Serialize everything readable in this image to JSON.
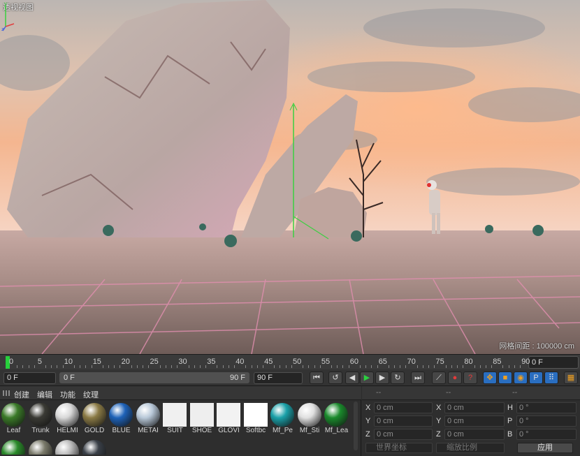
{
  "viewport": {
    "title": "透视视图",
    "grid_spacing": "网格间距 : 100000 cm"
  },
  "timeline": {
    "ticks": [
      "0",
      "5",
      "10",
      "15",
      "20",
      "25",
      "30",
      "35",
      "40",
      "45",
      "50",
      "55",
      "60",
      "65",
      "70",
      "75",
      "80",
      "85",
      "90"
    ],
    "end_field": "0 F",
    "current_frame": "0 F",
    "range_start": "0 F",
    "range_end": "90 F",
    "max_field": "90 F"
  },
  "transport": {
    "buttons": [
      {
        "name": "goto-start-icon",
        "glyph": "⏮"
      },
      {
        "name": "prev-key-icon",
        "glyph": "↺"
      },
      {
        "name": "prev-frame-icon",
        "glyph": "◀"
      },
      {
        "name": "play-icon",
        "glyph": "▶"
      },
      {
        "name": "next-frame-icon",
        "glyph": "▶"
      },
      {
        "name": "next-key-icon",
        "glyph": "↻"
      },
      {
        "name": "goto-end-icon",
        "glyph": "⏭"
      },
      {
        "name": "key-lock-icon",
        "glyph": "⟋"
      },
      {
        "name": "record-icon",
        "glyph": "●"
      },
      {
        "name": "autokey-icon",
        "glyph": "?"
      },
      {
        "name": "move-key-icon",
        "glyph": "✥"
      },
      {
        "name": "scale-key-icon",
        "glyph": "■"
      },
      {
        "name": "rotate-key-icon",
        "glyph": "◉"
      },
      {
        "name": "param-key-icon",
        "glyph": "P"
      },
      {
        "name": "pla-key-icon",
        "glyph": "⠿"
      },
      {
        "name": "film-icon",
        "glyph": "▦"
      }
    ]
  },
  "materials": {
    "menu": [
      "创建",
      "编辑",
      "功能",
      "纹理"
    ],
    "items": [
      {
        "label": "Leaf",
        "color": "#3a7a28"
      },
      {
        "label": "Trunk",
        "color": "#3a3a34"
      },
      {
        "label": "HELMI",
        "color": "#d8d8d8"
      },
      {
        "label": "GOLD",
        "color": "#8a7a45"
      },
      {
        "label": "BLUE",
        "color": "#1e62b8"
      },
      {
        "label": "METAI",
        "color": "#b8c8d8"
      },
      {
        "label": "SUIT",
        "color": "#f0f0f0"
      },
      {
        "label": "SHOE",
        "color": "#eeeeee"
      },
      {
        "label": "GLOVI",
        "color": "#f2f2f2"
      },
      {
        "label": "Softbc",
        "color": "#ffffff"
      },
      {
        "label": "Mf_Pe",
        "color": "#1aa0a8"
      },
      {
        "label": "Mf_Sti",
        "color": "#e0e0e0"
      },
      {
        "label": "Mf_Lea",
        "color": "#1a8a2c"
      }
    ],
    "row2": [
      {
        "color": "#2a8a2a"
      },
      {
        "color": "#7a7a6a"
      },
      {
        "color": "#bbbbbb"
      },
      {
        "color": "#3a4048"
      }
    ]
  },
  "coordinates": {
    "header": [
      "--",
      "--",
      "--"
    ],
    "rows": [
      {
        "a": "X",
        "av": "0 cm",
        "b": "X",
        "bv": "0 cm",
        "c": "H",
        "cv": "0 °"
      },
      {
        "a": "Y",
        "av": "0 cm",
        "b": "Y",
        "bv": "0 cm",
        "c": "P",
        "cv": "0 °"
      },
      {
        "a": "Z",
        "av": "0 cm",
        "b": "Z",
        "bv": "0 cm",
        "c": "B",
        "cv": "0 °"
      }
    ],
    "mode_dropdown": "世界坐标",
    "scale_dropdown": "缩放比例",
    "apply_label": "应用"
  }
}
